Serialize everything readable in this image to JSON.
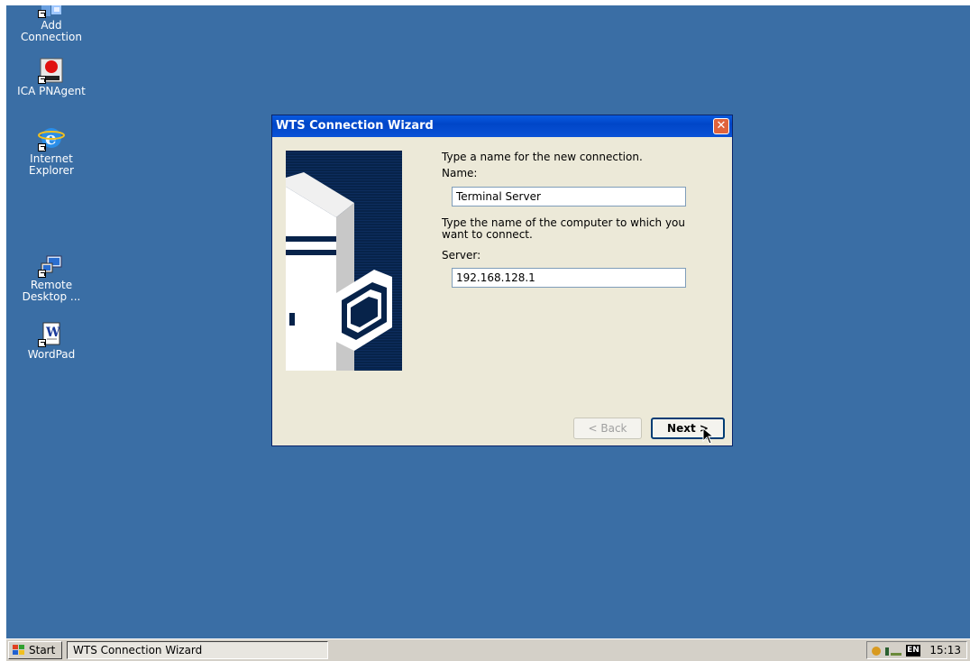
{
  "desktop": {
    "icons": [
      {
        "label": "Add Connection",
        "icon": "add-connection-icon"
      },
      {
        "label": "ICA PNAgent",
        "icon": "ica-pnagent-icon"
      },
      {
        "label": "Internet Explorer",
        "icon": "internet-explorer-icon"
      },
      {
        "label": "Remote Desktop ...",
        "icon": "remote-desktop-icon"
      },
      {
        "label": "WordPad",
        "icon": "wordpad-icon"
      }
    ]
  },
  "wizard": {
    "title": "WTS Connection Wizard",
    "close_glyph": "✕",
    "name_prompt": "Type a name for the new connection.",
    "name_label": "Name:",
    "name_value": "Terminal Server",
    "server_prompt_line1": "Type the name of the computer to which you",
    "server_prompt_line2": "want to connect.",
    "server_label": "Server:",
    "server_value": "192.168.128.1",
    "back_label": "< Back",
    "next_label": "Next >"
  },
  "taskbar": {
    "start_label": "Start",
    "task_label": "WTS Connection Wizard",
    "lang": "EN",
    "clock": "15:13"
  },
  "colors": {
    "desktop": "#3a6ea5",
    "titlebar": "#0046c8",
    "window": "#ece9d8",
    "close": "#e0633c"
  }
}
